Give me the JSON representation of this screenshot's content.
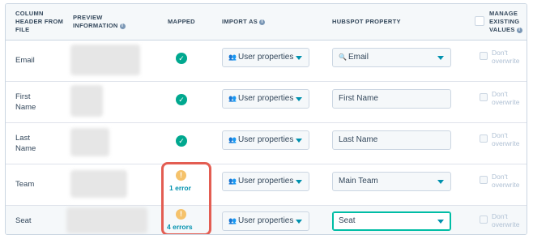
{
  "header": {
    "col_column_header": "COLUMN HEADER FROM FILE",
    "col_preview": "PREVIEW INFORMATION",
    "col_mapped": "MAPPED",
    "col_import_as": "IMPORT AS",
    "col_hubspot_property": "HUBSPOT PROPERTY",
    "col_manage": "MANAGE EXISTING VALUES",
    "info_icon": "info-icon"
  },
  "rows": [
    {
      "column": "Email",
      "mapped": "ok",
      "import_as": "User properties",
      "property": "Email",
      "property_icon": "search-icon",
      "overwrite_label": "Don't overwrite"
    },
    {
      "column": "First Name",
      "mapped": "ok",
      "import_as": "User properties",
      "property": "First Name",
      "overwrite_label": "Don't overwrite"
    },
    {
      "column": "Last Name",
      "mapped": "ok",
      "import_as": "User properties",
      "property": "Last Name",
      "overwrite_label": "Don't overwrite"
    },
    {
      "column": "Team",
      "mapped": "error",
      "error_text": "1 error",
      "import_as": "User properties",
      "property": "Main Team",
      "overwrite_label": "Don't overwrite"
    },
    {
      "column": "Seat",
      "mapped": "error",
      "error_text": "4 errors",
      "import_as": "User properties",
      "property": "Seat",
      "overwrite_label": "Don't overwrite"
    }
  ],
  "colors": {
    "success": "#00a88f",
    "warning": "#f5c26b",
    "link": "#0091ae",
    "highlight": "#e35d52"
  }
}
